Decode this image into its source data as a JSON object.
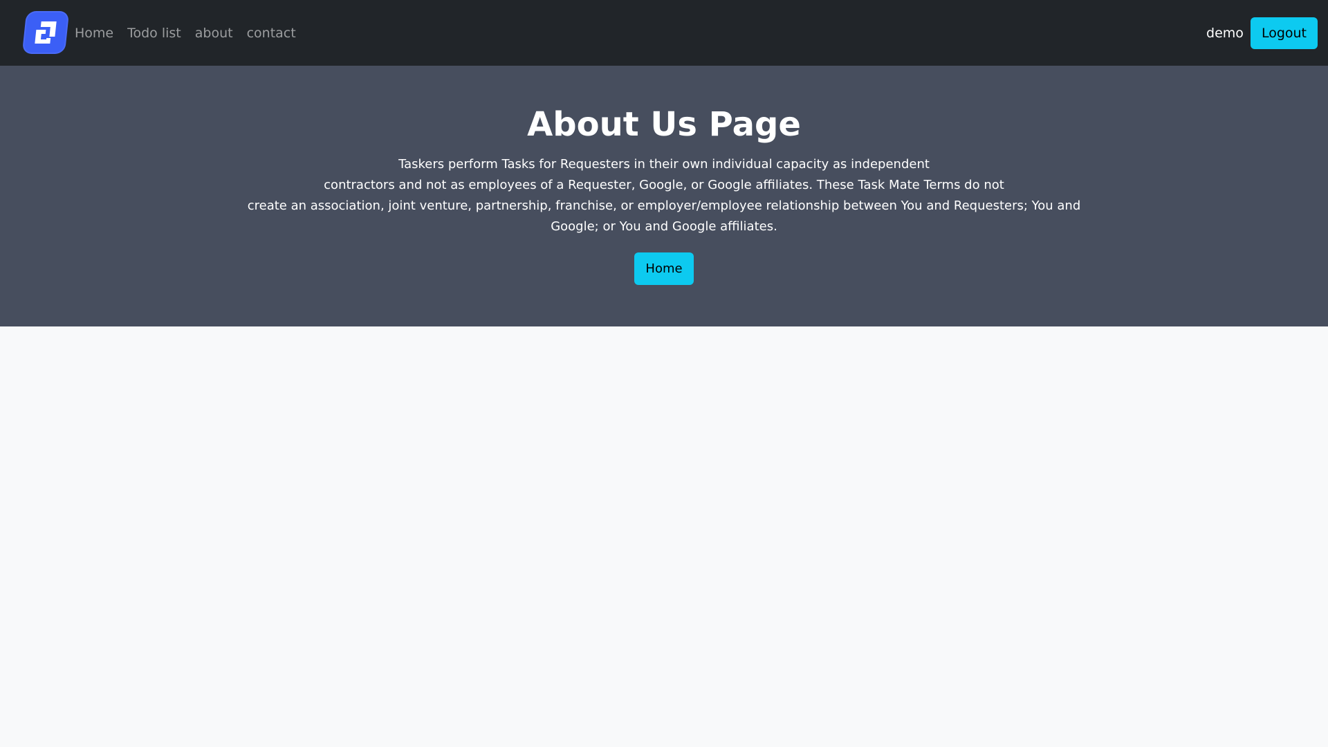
{
  "navbar": {
    "links": [
      "Home",
      "Todo list",
      "about",
      "contact"
    ],
    "username": "demo",
    "logout_label": "Logout"
  },
  "hero": {
    "title": "About Us Page",
    "lines": [
      "Taskers perform Tasks for Requesters in their own individual capacity as independent",
      "contractors and not as employees of a Requester, Google, or Google affiliates. These Task Mate Terms do not",
      "create an association, joint venture, partnership, franchise, or employer/employee relationship between You and Requesters; You and Google; or You and Google affiliates."
    ],
    "button_label": "Home"
  },
  "colors": {
    "navbar_bg": "#212529",
    "hero_bg": "#474e5e",
    "accent": "#0dcaf0",
    "logo": "#3b5ff6",
    "page_bg": "#f8f9fa"
  },
  "icons": {
    "brand": "app-logo-icon"
  }
}
